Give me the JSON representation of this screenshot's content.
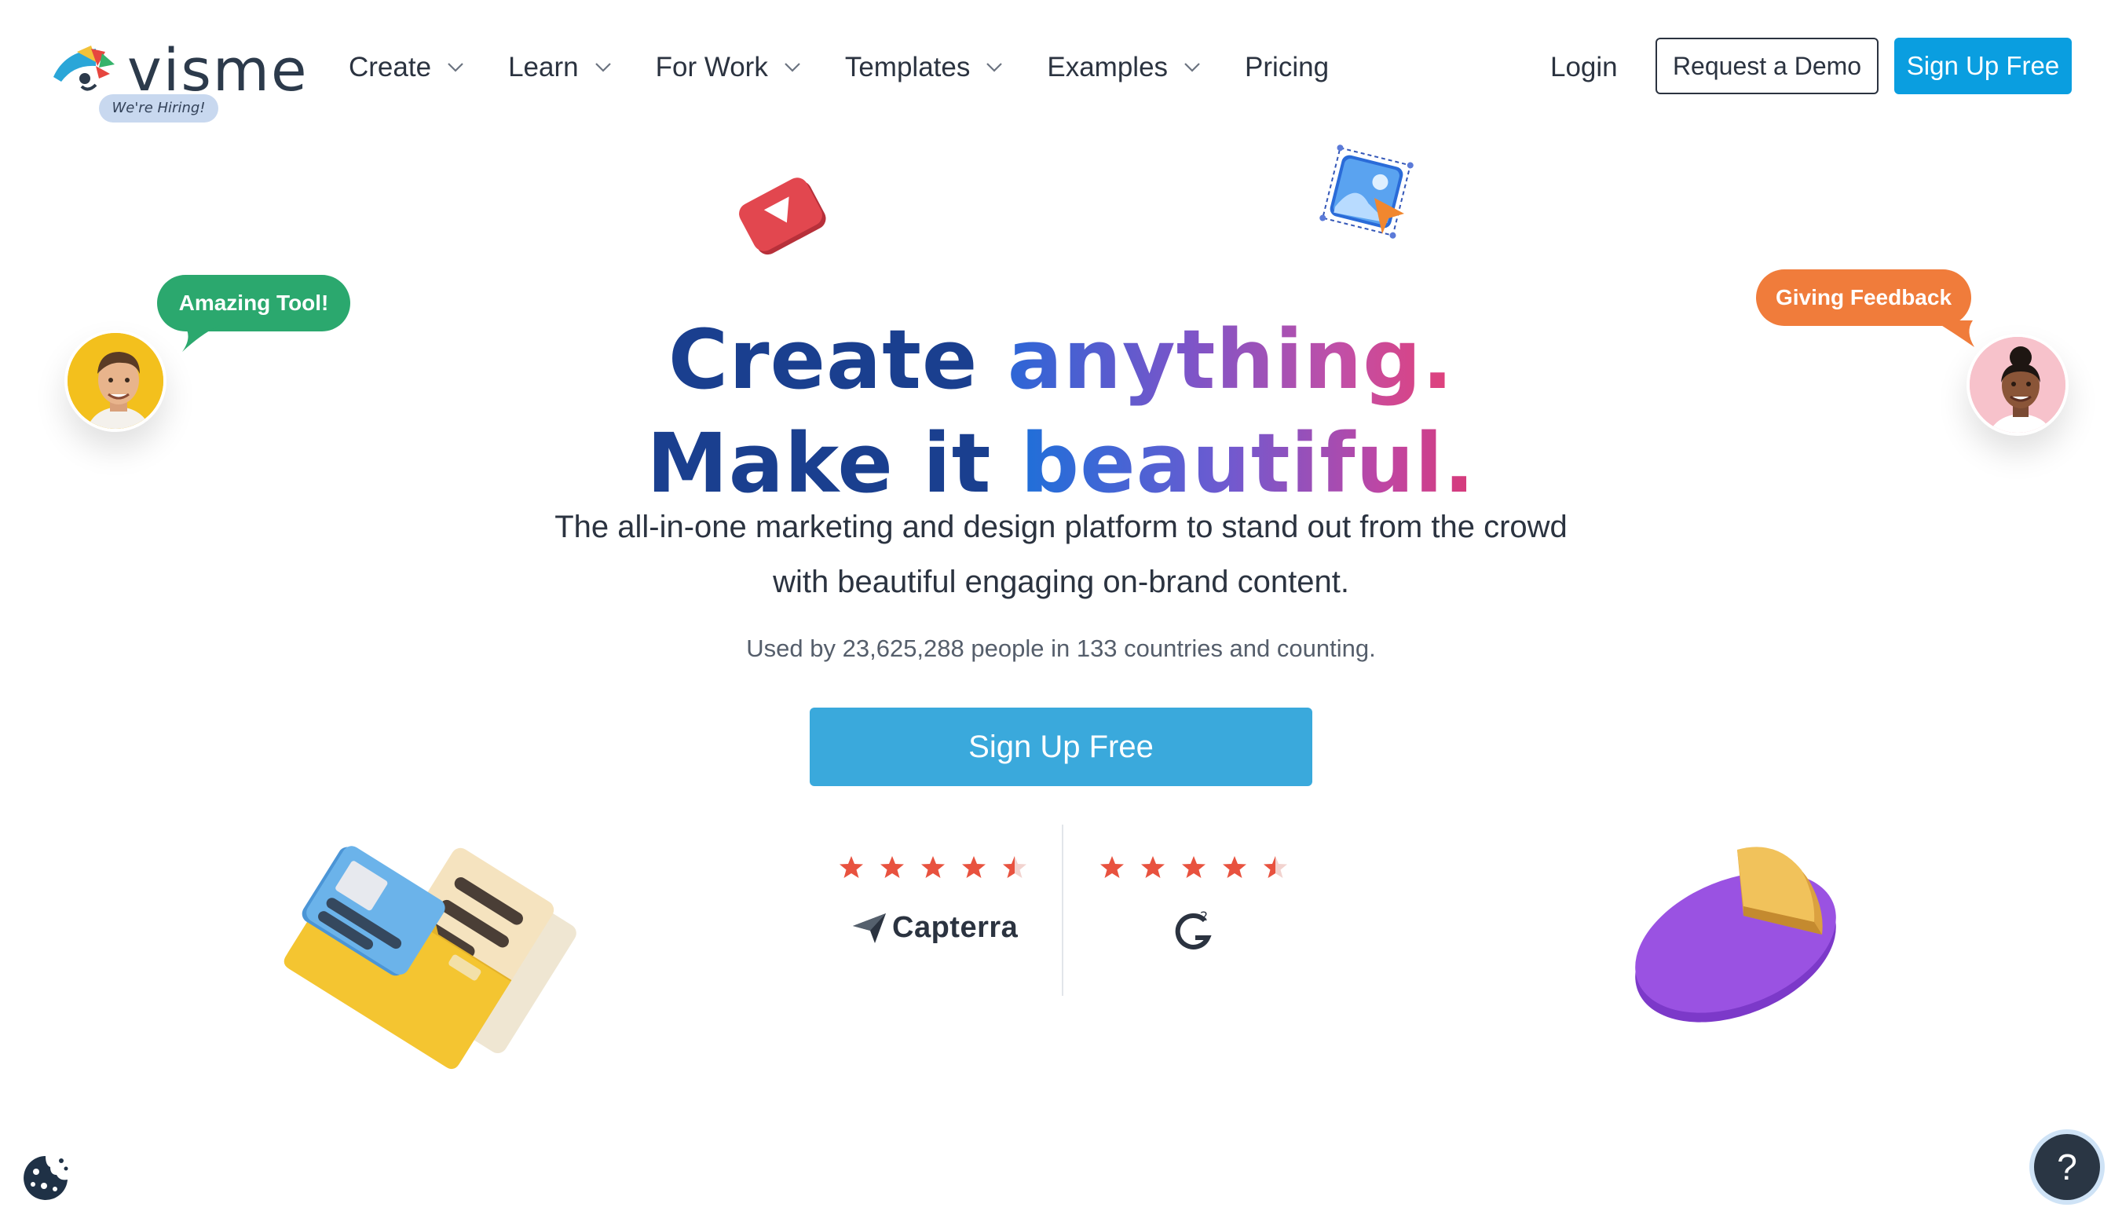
{
  "brand": {
    "name": "visme",
    "badge": "We're Hiring!"
  },
  "nav": {
    "items": [
      {
        "label": "Create",
        "has_dropdown": true
      },
      {
        "label": "Learn",
        "has_dropdown": true
      },
      {
        "label": "For Work",
        "has_dropdown": true
      },
      {
        "label": "Templates",
        "has_dropdown": true
      },
      {
        "label": "Examples",
        "has_dropdown": true
      },
      {
        "label": "Pricing",
        "has_dropdown": false
      }
    ],
    "login": "Login",
    "demo": "Request a Demo",
    "signup": "Sign Up Free"
  },
  "hero": {
    "line1_a": "Create ",
    "line1_b": "anything.",
    "line2_a": "Make it ",
    "line2_b": "beautiful.",
    "subtitle_1": "The all-in-one marketing and design platform to stand out from the crowd",
    "subtitle_2": "with beautiful engaging on-brand content.",
    "usage": "Used by 23,625,288 people in 133 countries and counting.",
    "cta": "Sign Up Free"
  },
  "ratings": [
    {
      "source": "Capterra",
      "stars": 4.5
    },
    {
      "source": "G2",
      "stars": 4.5
    }
  ],
  "testimonials": {
    "left_bubble": "Amazing Tool!",
    "right_bubble": "Giving Feedback"
  },
  "help": {
    "label": "?"
  },
  "colors": {
    "primary": "#0a9ee0",
    "cta": "#3aa9dc",
    "heading": "#1a3f8f",
    "star": "#e8523f",
    "bubble_green": "#2ba86e",
    "bubble_orange": "#f07c3b"
  }
}
